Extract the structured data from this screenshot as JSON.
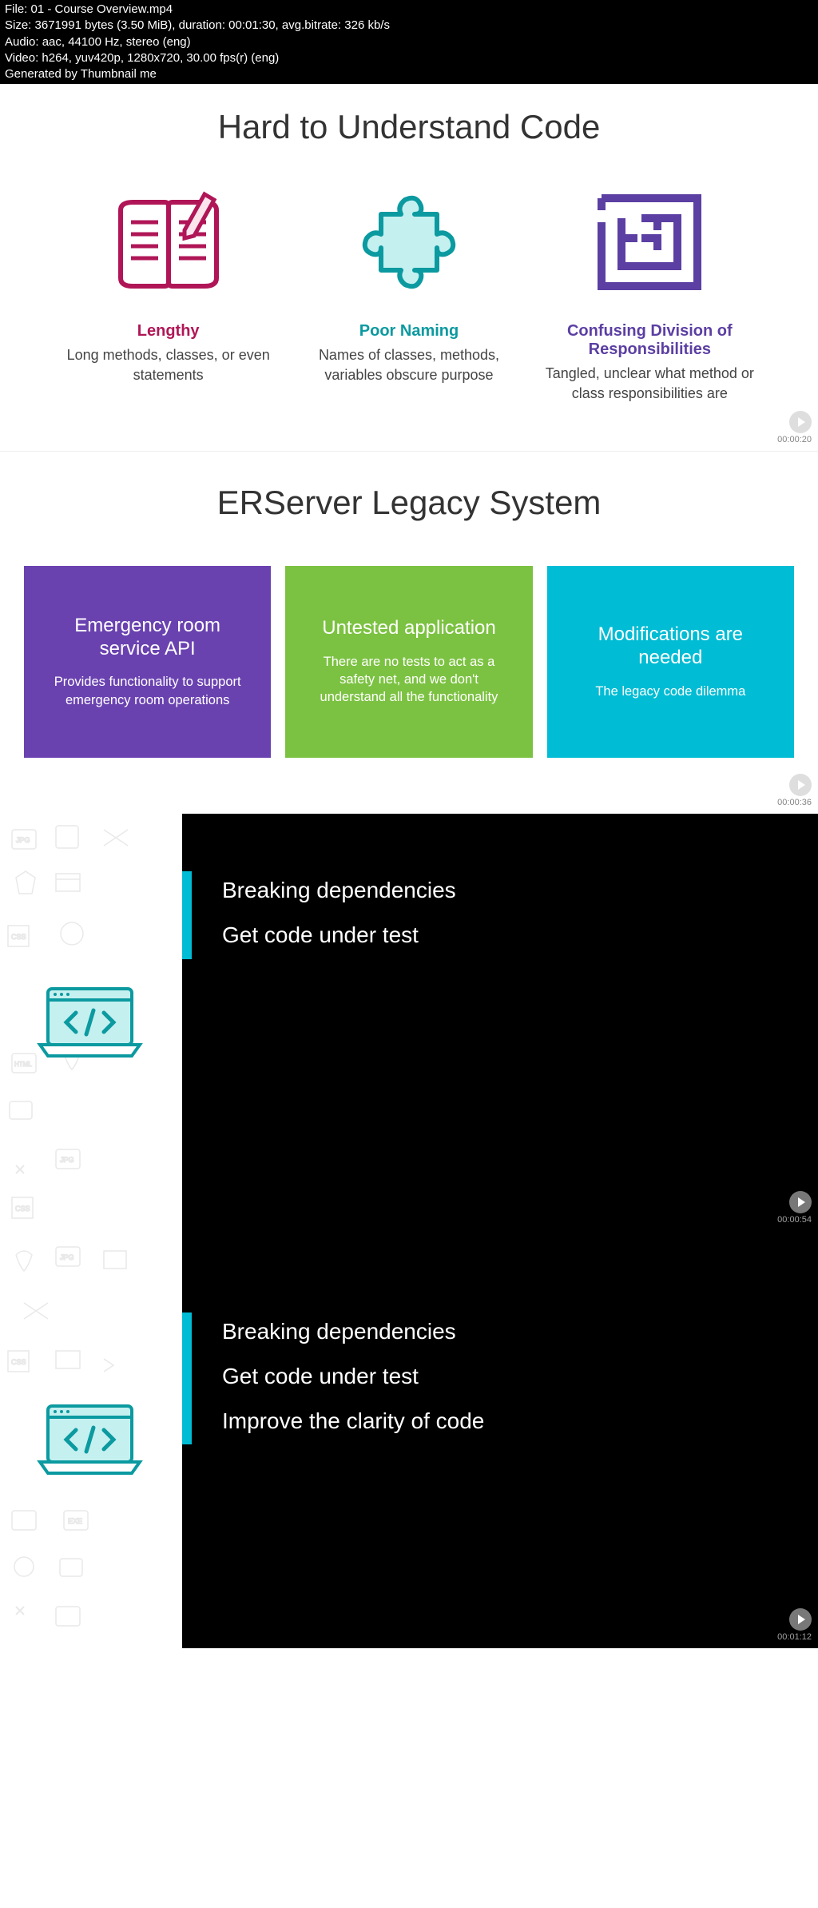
{
  "metadata": {
    "line1": "File: 01 - Course Overview.mp4",
    "line2": "Size: 3671991 bytes (3.50 MiB), duration: 00:01:30, avg.bitrate: 326 kb/s",
    "line3": "Audio: aac, 44100 Hz, stereo (eng)",
    "line4": "Video: h264, yuv420p, 1280x720, 30.00 fps(r) (eng)",
    "line5": "Generated by Thumbnail me"
  },
  "slide1": {
    "title": "Hard to Understand Code",
    "items": [
      {
        "heading": "Lengthy",
        "body": "Long methods, classes, or even statements"
      },
      {
        "heading": "Poor Naming",
        "body": "Names of classes, methods, variables obscure purpose"
      },
      {
        "heading": "Confusing Division of Responsibilities",
        "body": "Tangled, unclear what method or class responsibilities are"
      }
    ],
    "timestamp": "00:00:20"
  },
  "slide2": {
    "title": "ERServer Legacy System",
    "cards": [
      {
        "heading": "Emergency room service API",
        "body": "Provides functionality to support emergency room operations"
      },
      {
        "heading": "Untested application",
        "body": "There are no tests to act as a safety net, and we don't understand all the functionality"
      },
      {
        "heading": "Modifications are needed",
        "body": "The legacy code dilemma"
      }
    ],
    "timestamp": "00:00:36"
  },
  "slide3": {
    "lines": [
      "Breaking dependencies",
      "Get code under test"
    ],
    "timestamp": "00:00:54"
  },
  "slide4": {
    "lines": [
      "Breaking dependencies",
      "Get code under test",
      "Improve the clarity of code"
    ],
    "timestamp": "00:01:12"
  }
}
